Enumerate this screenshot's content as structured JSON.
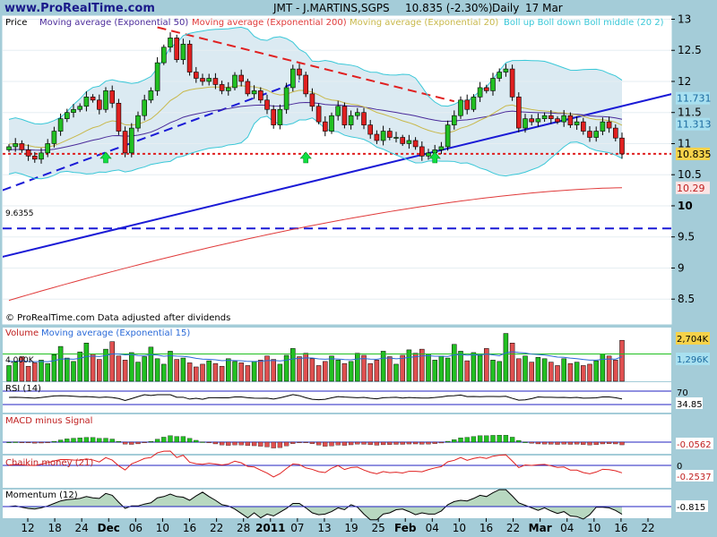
{
  "header": {
    "site": "www.ProRealTime.com",
    "title": "JMT - J.MARTINS,SGPS",
    "last": "10.835 (-2.30%)",
    "period": "Daily",
    "date": "17 Mar"
  },
  "price_panel": {
    "label": "Price",
    "legend": [
      {
        "text": "Moving average (Exponential 50)",
        "color": "#4a2a9a"
      },
      {
        "text": "Moving average (Exponential 200)",
        "color": "#e03a3a"
      },
      {
        "text": "Moving average (Exponential 20)",
        "color": "#c8b84a"
      },
      {
        "text": "Boll up Boll down Boll middle (20 2)",
        "color": "#3ac8d8"
      }
    ],
    "footer": "© ProRealTime.com  Data adjusted after dividends",
    "support_label": "9.6355",
    "badges": [
      {
        "text": "11.731",
        "bg": "#a8e0f0",
        "fg": "#1a6aa0",
        "value": 11.731
      },
      {
        "text": "11.313",
        "bg": "#a8e0f0",
        "fg": "#1a6aa0",
        "value": 11.313
      },
      {
        "text": "10.835",
        "bg": "#f6d24a",
        "fg": "#000000",
        "value": 10.835
      },
      {
        "text": "10.29",
        "bg": "#fbe4e4",
        "fg": "#c02020",
        "value": 10.29
      }
    ]
  },
  "volume_panel": {
    "label": "Volume",
    "legend": "Moving average (Exponential 15)",
    "level_label": "4,000K",
    "badges": [
      {
        "text": "2,704K",
        "bg": "#f6d24a",
        "fg": "#000000"
      },
      {
        "text": "1,296K",
        "bg": "#a8e0f0",
        "fg": "#1a6aa0"
      }
    ]
  },
  "rsi_panel": {
    "label": "RSI (14)",
    "level": "70",
    "value": "34.85"
  },
  "macd_panel": {
    "label": "MACD minus Signal",
    "value": "-0.0562"
  },
  "chaikin_panel": {
    "label": "Chaikin money (21)",
    "zero": "0",
    "value": "-0.2537"
  },
  "momentum_panel": {
    "label": "Momentum (12)",
    "value": "-0.815"
  },
  "chart_data": {
    "type": "candlestick",
    "title": "JMT - J.MARTINS,SGPS",
    "y_ticks": [
      "13",
      "12.5",
      "12",
      "11.5",
      "11",
      "10.5",
      "10",
      "9.5",
      "9",
      "8.5"
    ],
    "ylim": [
      8.1,
      13.05
    ],
    "x_labels": [
      {
        "text": "12",
        "bold": false
      },
      {
        "text": "18",
        "bold": false
      },
      {
        "text": "24",
        "bold": false
      },
      {
        "text": "Dec",
        "bold": true
      },
      {
        "text": "06",
        "bold": false
      },
      {
        "text": "10",
        "bold": false
      },
      {
        "text": "16",
        "bold": false
      },
      {
        "text": "22",
        "bold": false
      },
      {
        "text": "28",
        "bold": false
      },
      {
        "text": "2011",
        "bold": true
      },
      {
        "text": "07",
        "bold": false
      },
      {
        "text": "13",
        "bold": false
      },
      {
        "text": "19",
        "bold": false
      },
      {
        "text": "25",
        "bold": false
      },
      {
        "text": "Feb",
        "bold": true
      },
      {
        "text": "04",
        "bold": false
      },
      {
        "text": "10",
        "bold": false
      },
      {
        "text": "16",
        "bold": false
      },
      {
        "text": "22",
        "bold": false
      },
      {
        "text": "Mar",
        "bold": true
      },
      {
        "text": "04",
        "bold": false
      },
      {
        "text": "10",
        "bold": false
      },
      {
        "text": "16",
        "bold": false
      },
      {
        "text": "22",
        "bold": false
      }
    ],
    "close": [
      10.95,
      11.0,
      10.9,
      10.8,
      10.75,
      10.85,
      11.0,
      11.2,
      11.4,
      11.5,
      11.55,
      11.6,
      11.75,
      11.7,
      11.55,
      11.85,
      11.65,
      11.2,
      10.85,
      11.25,
      11.45,
      11.7,
      11.85,
      12.3,
      12.55,
      12.7,
      12.35,
      12.6,
      12.15,
      12.05,
      12.0,
      12.05,
      11.95,
      11.85,
      11.9,
      12.1,
      12.0,
      11.8,
      11.85,
      11.7,
      11.55,
      11.3,
      11.55,
      11.9,
      12.2,
      12.1,
      11.8,
      11.6,
      11.35,
      11.2,
      11.45,
      11.6,
      11.3,
      11.45,
      11.5,
      11.3,
      11.15,
      11.05,
      11.2,
      11.1,
      11.1,
      11.0,
      11.05,
      10.95,
      10.8,
      10.85,
      10.9,
      10.95,
      11.3,
      11.45,
      11.7,
      11.55,
      11.75,
      11.9,
      11.85,
      12.05,
      12.15,
      12.2,
      11.75,
      11.25,
      11.4,
      11.35,
      11.4,
      11.45,
      11.4,
      11.35,
      11.45,
      11.3,
      11.35,
      11.2,
      11.1,
      11.2,
      11.35,
      11.25,
      11.09,
      10.835
    ],
    "volume_k": [
      2300,
      2900,
      3600,
      2200,
      2700,
      3100,
      2600,
      3900,
      5100,
      3400,
      2900,
      4300,
      5600,
      4000,
      3200,
      4700,
      5800,
      3700,
      3100,
      4200,
      2800,
      3600,
      5000,
      3300,
      2500,
      4400,
      3200,
      3400,
      2700,
      2100,
      2500,
      3000,
      2600,
      2200,
      3300,
      2900,
      2700,
      2300,
      2900,
      3100,
      3700,
      3200,
      2500,
      3800,
      4800,
      3600,
      4100,
      3300,
      2300,
      2900,
      3700,
      3100,
      2600,
      2900,
      4100,
      3800,
      2600,
      3100,
      4400,
      3600,
      2500,
      3800,
      4600,
      4100,
      4700,
      4000,
      3100,
      3700,
      3400,
      5400,
      4400,
      3000,
      4200,
      3800,
      4800,
      3100,
      2900,
      7000,
      5600,
      3300,
      3700,
      2800,
      3500,
      3300,
      2800,
      2300,
      3300,
      2600,
      2800,
      2300,
      2500,
      3000,
      4000,
      3700,
      3100,
      6000
    ],
    "arrows_at_bar": [
      15,
      46,
      66
    ],
    "series_guides": [
      {
        "kind": "trendline",
        "color": "#1a1ad6",
        "p1": {
          "bar": -1,
          "price": 9.18
        },
        "p2": {
          "bar": 104,
          "price": 11.83
        },
        "dashed": false
      },
      {
        "kind": "trendline",
        "color": "#1a1ad6",
        "p1": {
          "bar": -1,
          "price": 10.25
        },
        "p2": {
          "bar": 45,
          "price": 12.0
        },
        "dashed": true
      },
      {
        "kind": "trendline",
        "color": "#e02020",
        "p1": {
          "bar": 23,
          "price": 12.87
        },
        "p2": {
          "bar": 69,
          "price": 11.68
        },
        "dashed": true
      },
      {
        "kind": "level",
        "color": "#1a1ad6",
        "price": 9.6355,
        "dashed": true
      },
      {
        "kind": "level",
        "color": "#e02020",
        "price": 10.835,
        "dashed": "dotted"
      }
    ]
  }
}
